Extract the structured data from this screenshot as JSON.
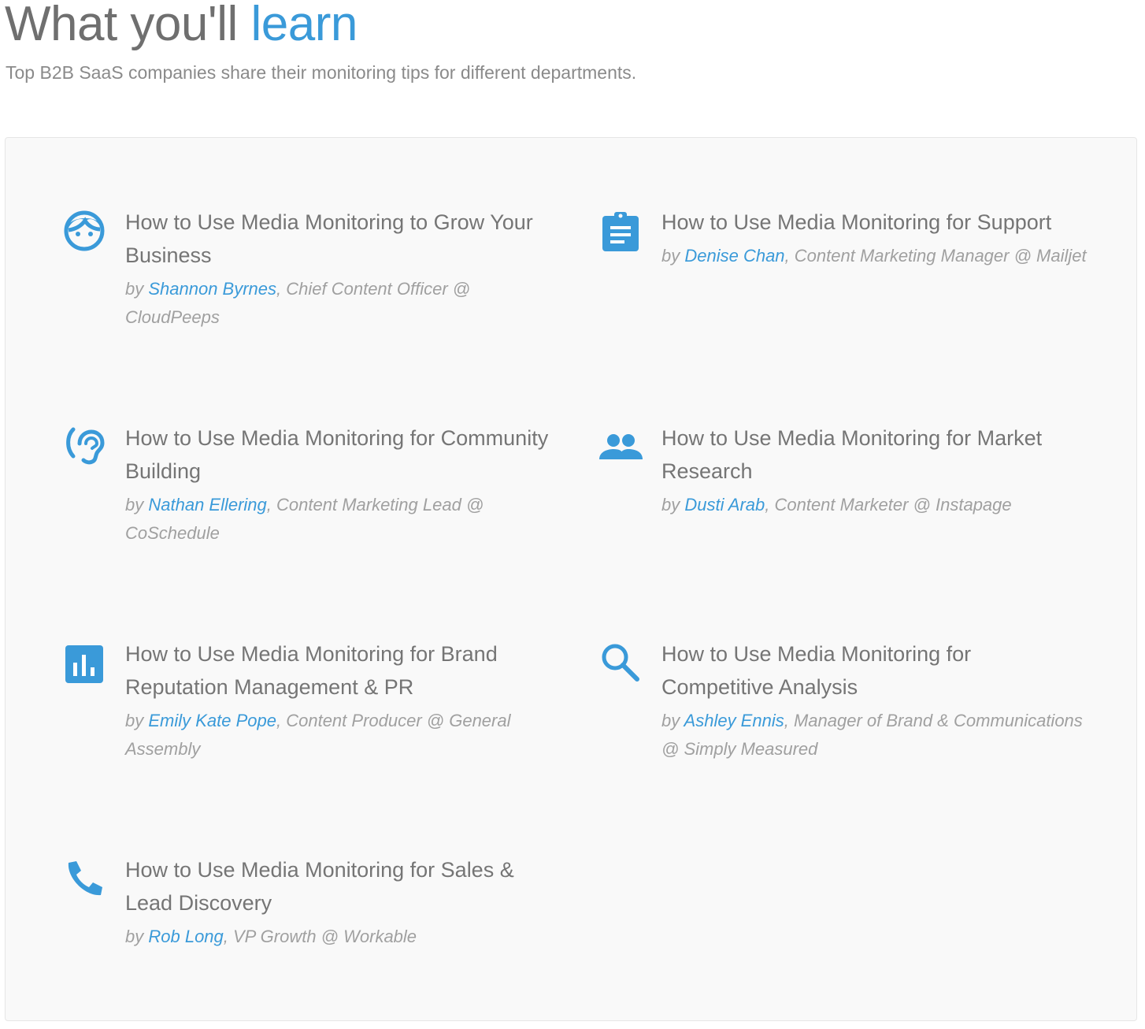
{
  "header": {
    "title_main": "What you'll ",
    "title_accent": "learn",
    "subtitle": "Top B2B SaaS companies share their monitoring tips for different departments."
  },
  "colors": {
    "accent": "#3a9ad9",
    "panel_bg": "#f9f9f9",
    "text": "#757575",
    "byline": "#a0a0a0"
  },
  "cards": [
    {
      "icon": "face-icon",
      "title": "How to Use Media Monitoring to Grow Your Business",
      "by": "by ",
      "author": "Shannon Byrnes",
      "role": ", Chief Content Officer @ CloudPeeps"
    },
    {
      "icon": "clipboard-icon",
      "title": "How to Use Media Monitoring for Support",
      "by": "by ",
      "author": "Denise Chan",
      "role": ", Content Marketing Manager @ Mailjet"
    },
    {
      "icon": "hearing-icon",
      "title": "How to Use Media Monitoring for Community Building",
      "by": "by ",
      "author": "Nathan Ellering",
      "role": ", Content Marketing Lead @ CoSchedule"
    },
    {
      "icon": "people-icon",
      "title": "How to Use Media Monitoring for Market Research",
      "by": "by ",
      "author": "Dusti Arab",
      "role": ", Content Marketer @ Instapage"
    },
    {
      "icon": "bar-chart-icon",
      "title": "How to Use Media Monitoring for Brand Reputation Management & PR",
      "by": "by ",
      "author": "Emily Kate Pope",
      "role": ", Content Producer @ General Assembly"
    },
    {
      "icon": "search-icon",
      "title": "How to Use Media Monitoring for Competitive Analysis",
      "by": "by ",
      "author": "Ashley Ennis",
      "role": ", Manager of Brand & Communications @ Simply Measured"
    },
    {
      "icon": "phone-icon",
      "title": "How to Use Media Monitoring for Sales & Lead Discovery",
      "by": "by ",
      "author": "Rob Long",
      "role": ", VP Growth @ Workable"
    }
  ]
}
